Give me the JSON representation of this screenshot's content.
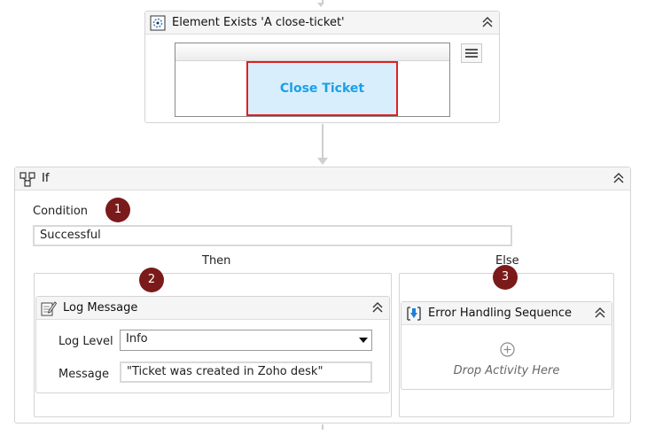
{
  "element_exists": {
    "title": "Element Exists 'A  close-ticket'",
    "preview_button": "Close Ticket"
  },
  "if_block": {
    "title": "If",
    "condition_label": "Condition",
    "condition_value": "Successful",
    "then_label": "Then",
    "else_label": "Else"
  },
  "log_message": {
    "title": "Log Message",
    "log_level_label": "Log Level",
    "log_level_value": "Info",
    "message_label": "Message",
    "message_value": "\"Ticket was created in Zoho desk\""
  },
  "error_handling": {
    "title": "Error Handling Sequence",
    "drop_text": "Drop Activity Here"
  },
  "badges": [
    "1",
    "2",
    "3"
  ],
  "colors": {
    "badge": "#7b1a1a",
    "preview_highlight": "#d9eefc",
    "preview_border": "#e02020",
    "preview_text": "#1aa0e8"
  }
}
